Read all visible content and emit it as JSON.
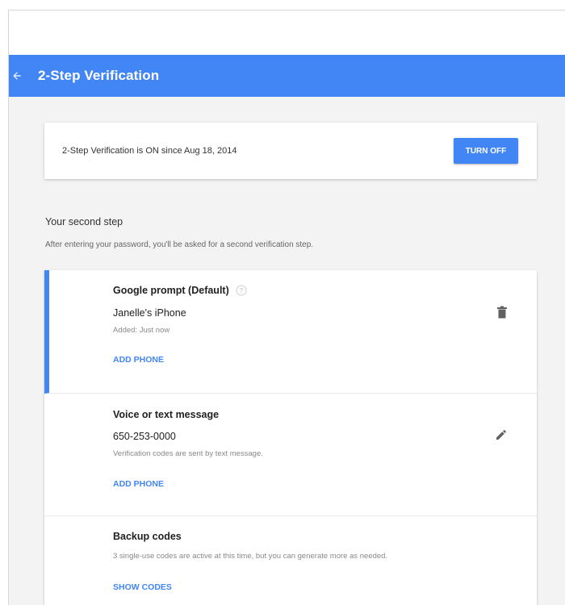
{
  "appbar": {
    "title": "2-Step Verification",
    "back_icon": "arrow-left-icon",
    "color": "#4285f4"
  },
  "status": {
    "text": "2-Step Verification is ON since Aug 18, 2014",
    "button_label": "TURN OFF"
  },
  "second_step": {
    "title": "Your second step",
    "description": "After entering your password, you'll be asked for a second verification step."
  },
  "methods": [
    {
      "title": "Google prompt (Default)",
      "device": "Janelle's iPhone",
      "note": "Added: Just now",
      "link": "ADD PHONE",
      "action_icon": "trash-icon",
      "selected": true
    },
    {
      "title": "Voice or text message",
      "device": "650-253-0000",
      "note": "Verification codes are sent by text message.",
      "link": "ADD PHONE",
      "action_icon": "pencil-icon"
    },
    {
      "title": "Backup codes",
      "note": "3 single-use codes are active at this time, but you can generate more as needed.",
      "link": "SHOW CODES"
    }
  ]
}
